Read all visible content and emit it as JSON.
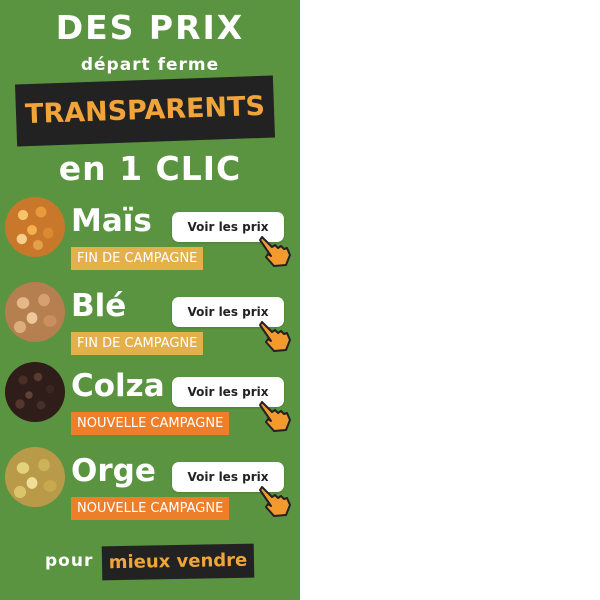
{
  "banner": {
    "line1": "DES PRIX",
    "line2": "départ ferme",
    "line3": "TRANSPARENTS",
    "line4": "en 1 CLIC",
    "crops": [
      {
        "name": "Maïs",
        "button": "Voir les prix",
        "campaign": "FIN DE CAMPAGNE",
        "campaign_color": "#e3b04b"
      },
      {
        "name": "Blé",
        "button": "Voir les prix",
        "campaign": "FIN DE CAMPAGNE",
        "campaign_color": "#e3b04b"
      },
      {
        "name": "Colza",
        "button": "Voir les prix",
        "campaign": "NOUVELLE CAMPAGNE",
        "campaign_color": "#ee7f2a"
      },
      {
        "name": "Orge",
        "button": "Voir les prix",
        "campaign": "NOUVELLE CAMPAGNE",
        "campaign_color": "#ee7f2a"
      }
    ],
    "footer_pour": "pour",
    "footer_highlight": "mieux vendre"
  },
  "colors": {
    "background": "#5a9440",
    "accent_orange": "#f0a43a",
    "dark_tag": "#222222"
  },
  "icons": [
    "maize-grain-icon",
    "wheat-grain-icon",
    "rapeseed-grain-icon",
    "barley-grain-icon",
    "pointing-hand-icon"
  ]
}
